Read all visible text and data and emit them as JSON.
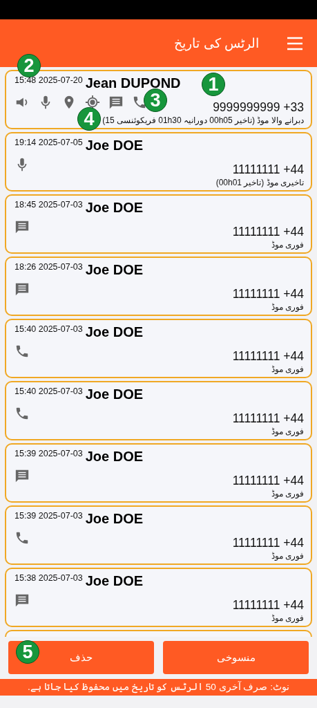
{
  "header": {
    "title": "الرٹس کی تاریخ"
  },
  "alerts": [
    {
      "datetime": "15:48 2025-07-20",
      "name": "Jean DUPOND",
      "phone": "9999999999 +33",
      "mode": "دبرانے والا موڈ (تاخیر 00h05 دورانیہ 01h30 فریکوئنسی 15)",
      "icons": [
        {
          "kind": "speaker"
        },
        {
          "kind": "mic"
        },
        {
          "kind": "pin"
        },
        {
          "kind": "target"
        },
        {
          "kind": "message"
        },
        {
          "kind": "phone"
        }
      ]
    },
    {
      "datetime": "19:14 2025-07-05",
      "name": "Joe DOE",
      "phone": "11111111 +44",
      "mode": "تاخیری موڈ (تاخیر 00h01)",
      "icons": [
        {
          "kind": "mic"
        }
      ]
    },
    {
      "datetime": "18:45 2025-07-03",
      "name": "Joe DOE",
      "phone": "11111111 +44",
      "mode": "فوری موڈ",
      "icons": [
        {
          "kind": "message"
        }
      ]
    },
    {
      "datetime": "18:26 2025-07-03",
      "name": "Joe DOE",
      "phone": "11111111 +44",
      "mode": "فوری موڈ",
      "icons": [
        {
          "kind": "message"
        }
      ]
    },
    {
      "datetime": "15:40 2025-07-03",
      "name": "Joe DOE",
      "phone": "11111111 +44",
      "mode": "فوری موڈ",
      "icons": [
        {
          "kind": "phone"
        }
      ]
    },
    {
      "datetime": "15:40 2025-07-03",
      "name": "Joe DOE",
      "phone": "11111111 +44",
      "mode": "فوری موڈ",
      "icons": [
        {
          "kind": "phone"
        }
      ]
    },
    {
      "datetime": "15:39 2025-07-03",
      "name": "Joe DOE",
      "phone": "11111111 +44",
      "mode": "فوری موڈ",
      "icons": [
        {
          "kind": "message"
        }
      ]
    },
    {
      "datetime": "15:39 2025-07-03",
      "name": "Joe DOE",
      "phone": "11111111 +44",
      "mode": "فوری موڈ",
      "icons": [
        {
          "kind": "phone"
        }
      ]
    },
    {
      "datetime": "15:38 2025-07-03",
      "name": "Joe DOE",
      "phone": "11111111 +44",
      "mode": "فوری موڈ",
      "icons": [
        {
          "kind": "message"
        }
      ]
    }
  ],
  "buttons": [
    {
      "label": "منسوخی"
    },
    {
      "label": "حذف"
    }
  ],
  "note": "نوٹ: صرف آخری 50 الرٹس کو تاریخ میں محفوظ کیا جاتا ہے.",
  "callouts": [
    "1",
    "2",
    "3",
    "4",
    "5"
  ]
}
